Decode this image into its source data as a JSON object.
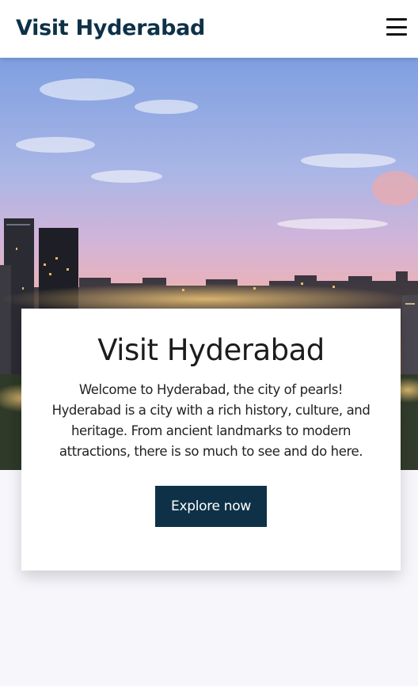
{
  "navbar": {
    "brand": "Visit Hyderabad",
    "menu_icon": "hamburger-menu-icon"
  },
  "hero": {
    "image": "hyderabad-skyline-at-dusk",
    "card": {
      "title": "Visit Hyderabad",
      "description": "Welcome to Hyderabad, the city of pearls! Hyderabad is a city with a rich history, culture, and heritage. From ancient landmarks to modern attractions, there is so much to see and do here.",
      "cta_label": "Explore now"
    }
  },
  "colors": {
    "brand": "#0e3147",
    "page_background": "#f7f6fb",
    "card_background": "#ffffff"
  }
}
